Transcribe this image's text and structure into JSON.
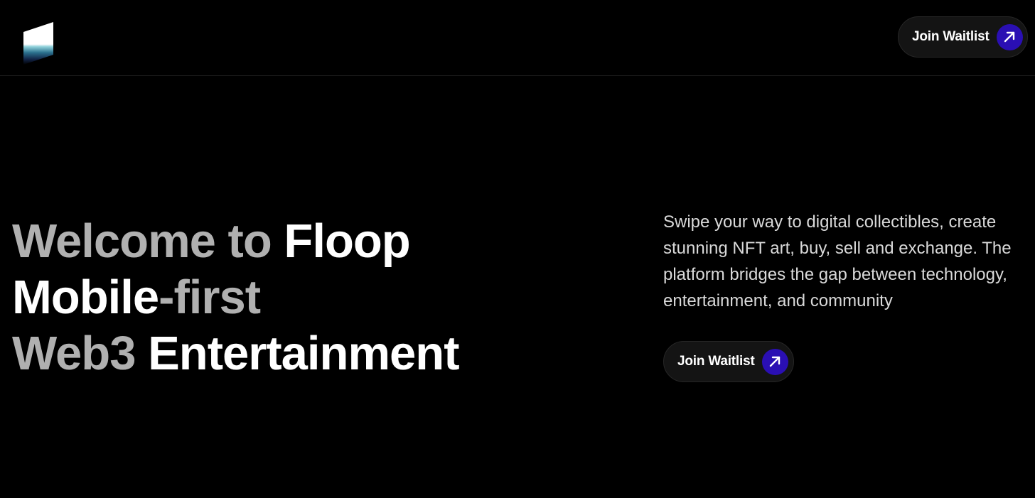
{
  "header": {
    "logo_icon": "floop-logo-icon",
    "cta_label": "Join Waitlist",
    "cta_icon": "arrow-up-right-icon"
  },
  "hero": {
    "headline": {
      "line1_muted": "Welcome to ",
      "line1_bright": "Floop",
      "line2_bright": "Mobile",
      "line2_muted": "-first",
      "line3_muted": "Web3 ",
      "line3_bright": "Entertainment"
    },
    "description": "Swipe your way to digital collectibles, create stunning NFT art, buy, sell and exchange. The platform bridges the gap between technology, entertainment, and community",
    "cta_label": "Join Waitlist",
    "cta_icon": "arrow-up-right-icon"
  },
  "colors": {
    "background": "#000000",
    "accent": "#2a0fb3",
    "muted_text": "#b0b0b0",
    "body_text": "#d9d9d9",
    "button_bg": "#141414"
  }
}
